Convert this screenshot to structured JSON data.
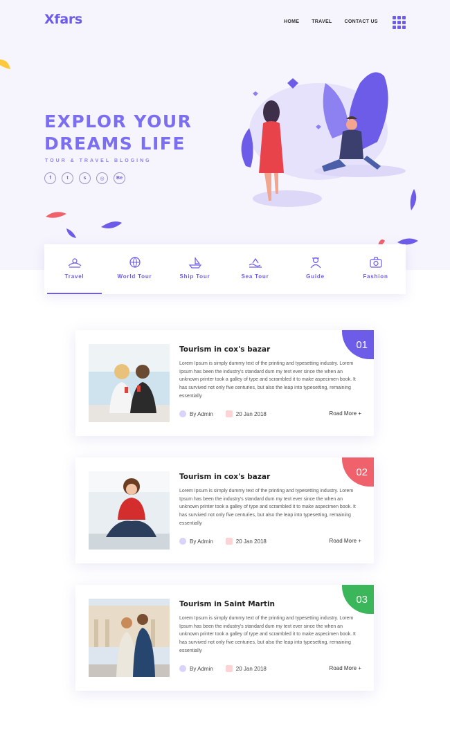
{
  "brand": {
    "logo": "Xfars",
    "accent": "#6c5ce7"
  },
  "nav": {
    "items": [
      "HOME",
      "TRAVEL",
      "CONTACT US"
    ],
    "menu_icon": "grid-menu-icon"
  },
  "hero": {
    "headline_line1": "EXPLOR YOUR",
    "headline_line2": "DREAMS LIFE",
    "tagline": "TOUR & TRAVEL BLOGING",
    "socials": [
      {
        "icon": "facebook-icon",
        "glyph": "f"
      },
      {
        "icon": "twitter-icon",
        "glyph": "t"
      },
      {
        "icon": "skype-icon",
        "glyph": "s"
      },
      {
        "icon": "dribbble-icon",
        "glyph": "◎"
      },
      {
        "icon": "behance-icon",
        "glyph": "Be"
      }
    ]
  },
  "tabs": [
    {
      "label": "Travel",
      "icon": "travel-icon",
      "active": true
    },
    {
      "label": "World Tour",
      "icon": "globe-icon",
      "active": false
    },
    {
      "label": "Ship Tour",
      "icon": "ship-icon",
      "active": false
    },
    {
      "label": "Sea Tour",
      "icon": "sea-icon",
      "active": false
    },
    {
      "label": "Guide",
      "icon": "guide-icon",
      "active": false
    },
    {
      "label": "Fashion",
      "icon": "camera-icon",
      "active": false
    }
  ],
  "posts": [
    {
      "number": "01",
      "badge_color": "#6c5ce7",
      "title": "Tourism in cox's bazar",
      "body": "Lorem Ipsum is simply dummy text of the printing and typesetting industry. Lorem Ipsum has been the industry's standard dum my text ever since the when an unknown printer took a galley of type and scrambled it to make aspecimen book. It has survived not only five centuries, but also the leap into typesetting, remaining essentially",
      "author": "By Admin",
      "date": "20 Jan 2018",
      "more": "Road More +"
    },
    {
      "number": "02",
      "badge_color": "#f0626b",
      "title": "Tourism in cox's bazar",
      "body": "Lorem Ipsum is simply dummy text of the printing and typesetting industry. Lorem Ipsum has been the industry's standard dum my text ever since the when an unknown printer took a galley of type and scrambled it to make aspecimen book. It has survived not only five centuries, but also the leap into typesetting, remaining essentially",
      "author": "By Admin",
      "date": "20 Jan 2018",
      "more": "Road More +"
    },
    {
      "number": "03",
      "badge_color": "#3cb65a",
      "title": "Tourism in Saint Martin",
      "body": "Lorem Ipsum is simply dummy text of the printing and typesetting industry. Lorem Ipsum has been the industry's standard dum my text ever since the when an unknown printer took a galley of type and scrambled it to make aspecimen book. It has survived not only five centuries, but also the leap into typesetting, remaining essentially",
      "author": "By Admin",
      "date": "20 Jan 2018",
      "more": "Road More +"
    }
  ]
}
